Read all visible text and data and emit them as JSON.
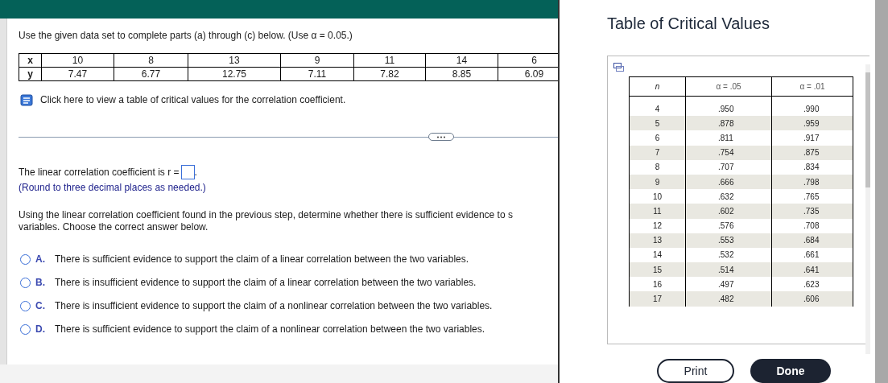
{
  "question": {
    "instruction": "Use the given data set to complete parts (a) through (c) below. (Use α = 0.05.)",
    "data_table": {
      "rows": [
        {
          "label": "x",
          "values": [
            "10",
            "8",
            "13",
            "9",
            "11",
            "14",
            "6"
          ]
        },
        {
          "label": "y",
          "values": [
            "7.47",
            "6.77",
            "12.75",
            "7.11",
            "7.82",
            "8.85",
            "6.09"
          ]
        }
      ]
    },
    "critical_values_link": "Click here to view a table of critical values for the correlation coefficient.",
    "answer_prompt": "The linear correlation coefficient is r =",
    "answer_suffix": ".",
    "round_hint": "(Round to three decimal places as needed.)",
    "followup": [
      "Using the linear correlation coefficient found in the previous step, determine whether there is sufficient evidence to s",
      "variables. Choose the correct answer below."
    ],
    "options": [
      {
        "letter": "A.",
        "text": "There is sufficient evidence to support the claim of a linear correlation between the two variables.",
        "selected": false
      },
      {
        "letter": "B.",
        "text": "There is insufficient evidence to support the claim of a linear correlation between the two variables.",
        "selected": false
      },
      {
        "letter": "C.",
        "text": "There is insufficient evidence to support the claim of a nonlinear correlation between the two variables.",
        "selected": false
      },
      {
        "letter": "D.",
        "text": "There is sufficient evidence to support the claim of a nonlinear correlation between the two variables.",
        "selected": false
      }
    ]
  },
  "dialog": {
    "title": "Table of Critical Values",
    "table": {
      "columns": [
        "n",
        "α = .05",
        "α = .01"
      ],
      "rows": [
        [
          "4",
          ".950",
          ".990"
        ],
        [
          "5",
          ".878",
          ".959"
        ],
        [
          "6",
          ".811",
          ".917"
        ],
        [
          "7",
          ".754",
          ".875"
        ],
        [
          "8",
          ".707",
          ".834"
        ],
        [
          "9",
          ".666",
          ".798"
        ],
        [
          "10",
          ".632",
          ".765"
        ],
        [
          "11",
          ".602",
          ".735"
        ],
        [
          "12",
          ".576",
          ".708"
        ],
        [
          "13",
          ".553",
          ".684"
        ],
        [
          "14",
          ".532",
          ".661"
        ],
        [
          "15",
          ".514",
          ".641"
        ],
        [
          "16",
          ".497",
          ".623"
        ],
        [
          "17",
          ".482",
          ".606"
        ]
      ]
    },
    "buttons": [
      {
        "label": "Print",
        "kind": "secondary"
      },
      {
        "label": "Done",
        "kind": "primary"
      }
    ]
  }
}
